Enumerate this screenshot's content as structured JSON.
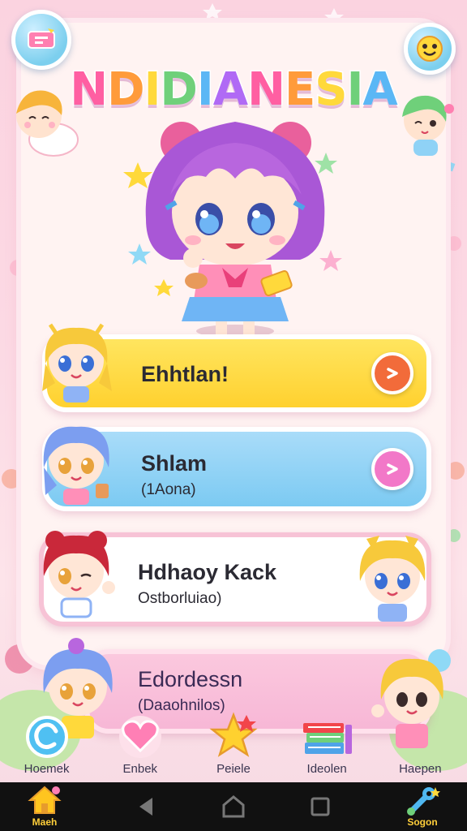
{
  "app": {
    "title": "NDIDIANESIA"
  },
  "characters": [
    {
      "name": "Ehhtlan!",
      "subtitle": "",
      "color": "#ffd93b",
      "button_color": "#f26b3a"
    },
    {
      "name": "Shlam",
      "subtitle": "(1Aona)",
      "color": "#8fd2f6",
      "button_color": "#f278c8"
    },
    {
      "name": "Hdhaoy Kack",
      "subtitle": "Ostborluiao)",
      "color": "#ffffff",
      "button_color": ""
    },
    {
      "name": "Edordessn",
      "subtitle": "(Daaohnilos)",
      "color": "#f7b7d6",
      "button_color": ""
    }
  ],
  "bottom_nav": [
    {
      "label": "Hoemek",
      "icon": "swirl-icon"
    },
    {
      "label": "Enbek",
      "icon": "heart-icon"
    },
    {
      "label": "Peiele",
      "icon": "star-icon"
    },
    {
      "label": "Ideolen",
      "icon": "books-icon"
    },
    {
      "label": "Haepen",
      "icon": "character-icon"
    }
  ],
  "system_bar": {
    "left_label": "Maeh",
    "right_label": "Sogon"
  },
  "colors": {
    "title_gradient": [
      "#ff5fa2",
      "#ff9b3a",
      "#ffd93b",
      "#6fd07a",
      "#5bb7f5",
      "#b06af5"
    ],
    "panel": "#fff3f2"
  }
}
